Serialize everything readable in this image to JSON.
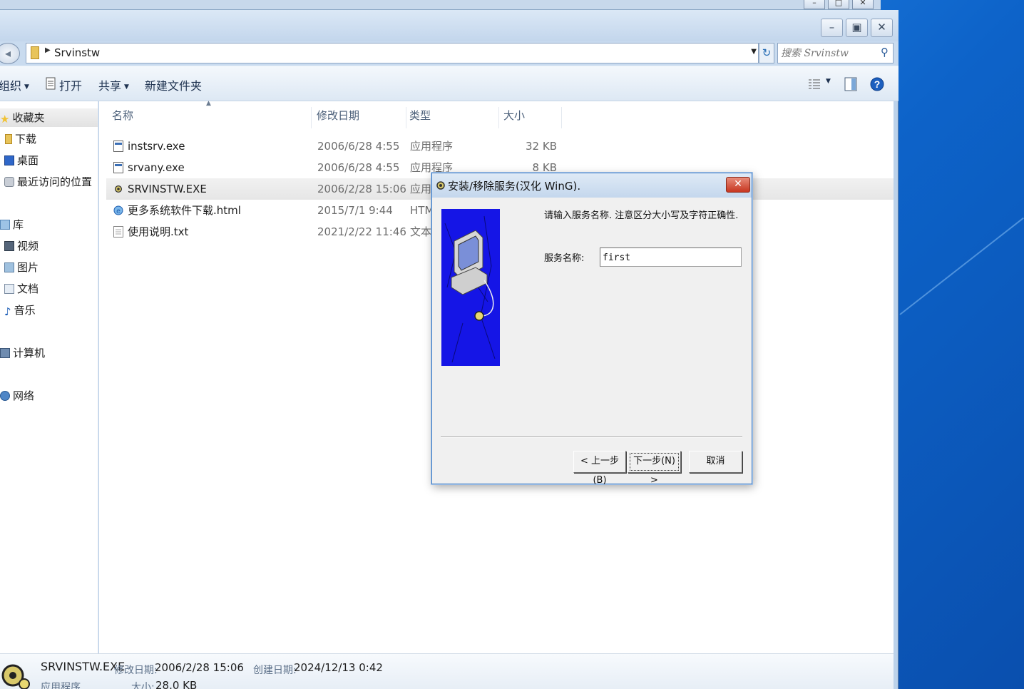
{
  "explorer": {
    "address": {
      "crumb": "Srvinstw"
    },
    "search": {
      "placeholder": "搜索 Srvinstw"
    },
    "toolbar": {
      "organize": "组织",
      "open": "打开",
      "share": "共享",
      "new_folder": "新建文件夹"
    },
    "nav": {
      "favorites": "收藏夹",
      "downloads": "下载",
      "desktop": "桌面",
      "recent": "最近访问的位置",
      "libraries": "库",
      "videos": "视频",
      "pictures": "图片",
      "documents": "文档",
      "music": "音乐",
      "computer": "计算机",
      "network": "网络"
    },
    "columns": {
      "name": "名称",
      "date": "修改日期",
      "type": "类型",
      "size": "大小"
    },
    "files": [
      {
        "name": "instsrv.exe",
        "date": "2006/6/28 4:55",
        "type": "应用程序",
        "size": "32 KB"
      },
      {
        "name": "srvany.exe",
        "date": "2006/6/28 4:55",
        "type": "应用程序",
        "size": "8 KB"
      },
      {
        "name": "SRVINSTW.EXE",
        "date": "2006/2/28 15:06",
        "type": "应用程序",
        "size": ""
      },
      {
        "name": "更多系统软件下载.html",
        "date": "2015/7/1 9:44",
        "type": "HTML",
        "size": ""
      },
      {
        "name": "使用说明.txt",
        "date": "2021/2/22 11:46",
        "type": "文本文",
        "size": ""
      }
    ],
    "details": {
      "name": "SRVINSTW.EXE",
      "type": "应用程序",
      "modified_label": "修改日期:",
      "modified": "2006/2/28 15:06",
      "created_label": "创建日期:",
      "created": "2024/12/13 0:42",
      "size_label": "大小:",
      "size": "28.0 KB"
    }
  },
  "dialog": {
    "title": "安装/移除服务(汉化 WinG).",
    "prompt": "请输入服务名称. 注意区分大小写及字符正确性.",
    "service_label": "服务名称:",
    "service_value": "first",
    "back_button": "< 上一步(B)",
    "next_button": "下一步(N) >",
    "cancel_button": "取消"
  },
  "colors": {
    "desktop": "#1f7de0",
    "dialog_image_bg": "#1515e6",
    "close_red": "#c73620"
  }
}
